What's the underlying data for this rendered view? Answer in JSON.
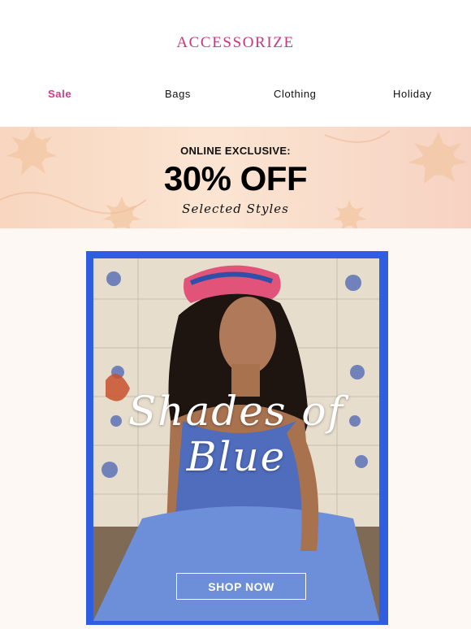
{
  "header": {
    "logo": "ACCESSORIZE"
  },
  "nav": {
    "items": [
      {
        "label": "Sale"
      },
      {
        "label": "Bags"
      },
      {
        "label": "Clothing"
      },
      {
        "label": "Holiday"
      }
    ]
  },
  "banner": {
    "line1": "ONLINE EXCLUSIVE:",
    "line2": "30% OFF",
    "line3": "Selected Styles"
  },
  "hero": {
    "title_line1": "Shades of",
    "title_line2": "Blue",
    "cta_label": "SHOP NOW"
  },
  "colors": {
    "brand": "#c8357f",
    "sale": "#d13a86",
    "frame_blue": "#2f5fe0",
    "banner_peach": "#fbe5d2",
    "page_bg": "#fdf8f4"
  },
  "icons": {
    "banner_decoration": "sun-motif-icon"
  }
}
